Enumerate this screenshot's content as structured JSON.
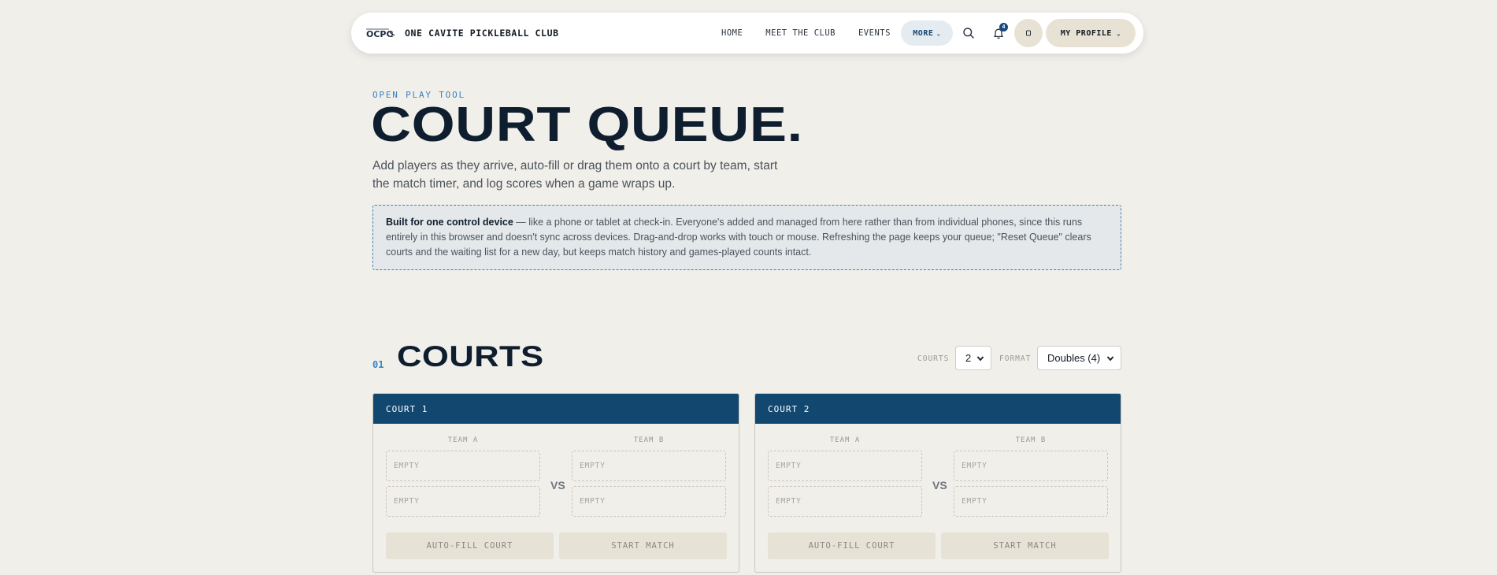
{
  "nav": {
    "brand_name": "ONE CAVITE PICKLEBALL CLUB",
    "logo_text": "OCPC",
    "links": [
      "HOME",
      "MEET THE CLUB",
      "EVENTS"
    ],
    "more_label": "MORE",
    "notification_count": "4",
    "profile_label": "MY PROFILE"
  },
  "hero": {
    "eyebrow": "OPEN PLAY TOOL",
    "title": "COURT QUEUE.",
    "description": "Add players as they arrive, auto-fill or drag them onto a court by team, start the match timer, and log scores when a game wraps up.",
    "notice_bold": "Built for one control device",
    "notice_text": " — like a phone or tablet at check-in. Everyone's added and managed from here rather than from individual phones, since this runs entirely in this browser and doesn't sync across devices. Drag-and-drop works with touch or mouse. Refreshing the page keeps your queue; \"Reset Queue\" clears courts and the waiting list for a new day, but keeps match history and games-played counts intact."
  },
  "courts_section": {
    "number": "01",
    "title": "COURTS",
    "courts_label": "COURTS",
    "courts_value": "2",
    "format_label": "FORMAT",
    "format_value": "Doubles (4)",
    "courts": [
      {
        "name": "COURT 1",
        "team_a_label": "TEAM A",
        "team_b_label": "TEAM B",
        "team_a_slots": [
          "EMPTY",
          "EMPTY"
        ],
        "team_b_slots": [
          "EMPTY",
          "EMPTY"
        ],
        "vs_label": "VS",
        "autofill_label": "AUTO-FILL COURT",
        "start_label": "START MATCH"
      },
      {
        "name": "COURT 2",
        "team_a_label": "TEAM A",
        "team_b_label": "TEAM B",
        "team_a_slots": [
          "EMPTY",
          "EMPTY"
        ],
        "team_b_slots": [
          "EMPTY",
          "EMPTY"
        ],
        "vs_label": "VS",
        "autofill_label": "AUTO-FILL COURT",
        "start_label": "START MATCH"
      }
    ]
  },
  "colors": {
    "background": "#f1efea",
    "navy": "#12476f",
    "accent_blue": "#3a83c4",
    "button_beige": "#e6e2d5"
  }
}
